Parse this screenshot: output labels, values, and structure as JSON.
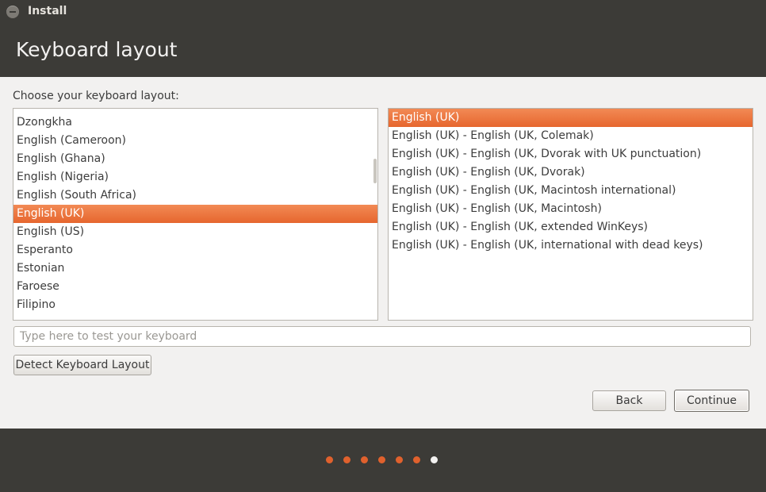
{
  "window": {
    "title": "Install"
  },
  "header": {
    "title": "Keyboard layout"
  },
  "main": {
    "prompt": "Choose your keyboard layout:",
    "layouts": [
      "Dzongkha",
      "English (Cameroon)",
      "English (Ghana)",
      "English (Nigeria)",
      "English (South Africa)",
      "English (UK)",
      "English (US)",
      "Esperanto",
      "Estonian",
      "Faroese",
      "Filipino"
    ],
    "selected_layout": "English (UK)",
    "variants": [
      "English (UK)",
      "English (UK) - English (UK, Colemak)",
      "English (UK) - English (UK, Dvorak with UK punctuation)",
      "English (UK) - English (UK, Dvorak)",
      "English (UK) - English (UK, Macintosh international)",
      "English (UK) - English (UK, Macintosh)",
      "English (UK) - English (UK, extended WinKeys)",
      "English (UK) - English (UK, international with dead keys)"
    ],
    "selected_variant": "English (UK)",
    "test_placeholder": "Type here to test your keyboard",
    "test_value": "",
    "detect_label": "Detect Keyboard Layout"
  },
  "buttons": {
    "back": "Back",
    "continue": "Continue"
  },
  "progress": {
    "total_steps": 7,
    "current_step": 7
  },
  "colors": {
    "accent": "#e6662e",
    "dot_done": "#e0612d",
    "dot_current": "#f2f1f0",
    "chrome": "#3c3b37",
    "body": "#f2f1f0"
  },
  "icons": {
    "window_close": "close-icon"
  }
}
